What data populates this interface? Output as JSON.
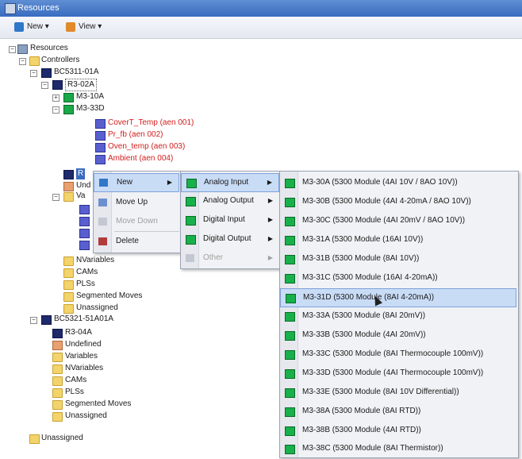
{
  "window": {
    "title": "Resources"
  },
  "toolbar": {
    "new_label": "New ▾",
    "view_label": "View ▾"
  },
  "tree": {
    "resources": "Resources",
    "controllers": "Controllers",
    "bc1": "BC5311-01A",
    "r302a": "R3-02A",
    "m310a": "M3-10A",
    "m333d": "M3-33D",
    "ch1": "CoverT_Temp (aen 001)",
    "ch2": "Pr_fb (aen 002)",
    "ch3": "Oven_temp (aen 003)",
    "ch4": "Ambient (aen 004)",
    "row_r3": "R",
    "row_und": "Und",
    "row_va": "Va",
    "nvariables": "NVariables",
    "cams": "CAMs",
    "plss": "PLSs",
    "segmoves": "Segmented Moves",
    "unassigned": "Unassigned",
    "bc2": "BC5321-51A01A",
    "r304a": "R3-04A",
    "undefined": "Undefined",
    "variables": "Variables",
    "nvariables2": "NVariables",
    "cams2": "CAMs",
    "plss2": "PLSs",
    "segmoves2": "Segmented Moves",
    "unassigned2": "Unassigned",
    "unassigned_root": "Unassigned"
  },
  "context_menu": {
    "new": "New",
    "move_up": "Move Up",
    "move_down": "Move Down",
    "delete": "Delete"
  },
  "new_submenu": {
    "analog_input": "Analog Input",
    "analog_output": "Analog Output",
    "digital_input": "Digital Input",
    "digital_output": "Digital Output",
    "other": "Other"
  },
  "analog_input_submenu": [
    "M3-30A (5300 Module (4AI 10V / 8AO 10V))",
    "M3-30B (5300 Module (4AI 4-20mA / 8AO 10V))",
    "M3-30C (5300 Module (4AI 20mV / 8AO 10V))",
    "M3-31A (5300 Module (16AI 10V))",
    "M3-31B (5300 Module (8AI 10V))",
    "M3-31C (5300 Module (16AI 4-20mA))",
    "M3-31D (5300 Module (8AI 4-20mA))",
    "M3-33A (5300 Module (8AI 20mV))",
    "M3-33B (5300 Module (4AI 20mV))",
    "M3-33C (5300 Module (8AI Thermocouple 100mV))",
    "M3-33D (5300 Module (4AI Thermocouple 100mV))",
    "M3-33E (5300 Module (8AI 10V Differential))",
    "M3-38A (5300 Module (8AI RTD))",
    "M3-38B (5300 Module (4AI RTD))",
    "M3-38C (5300 Module (8AI Thermistor))"
  ],
  "colors": {
    "title": "#3a6cc0",
    "red_channel": "#d31d1d",
    "highlight": "#c9dcf6"
  }
}
